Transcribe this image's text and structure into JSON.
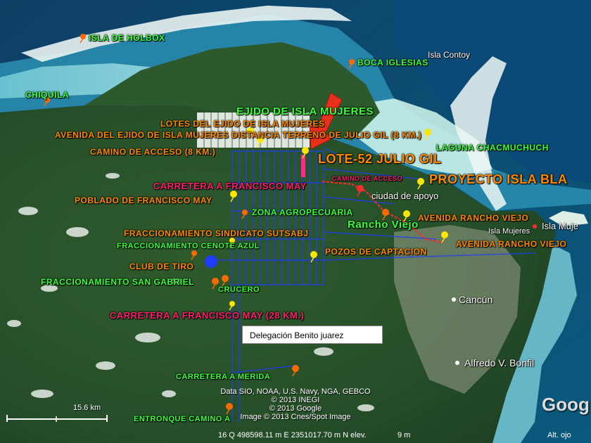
{
  "labels": {
    "isla_holbox": "ISLA DE HOLBOX",
    "boca_iglesias": "BOCA IGLESIAS",
    "isla_contoy": "Isla Contoy",
    "chiquila": "CHIQUILA",
    "ejido_title": "EJIDO DE ISLA MUJERES",
    "lotes_ejido": "LOTES DEL EJIDO DE ISLA MUJERES",
    "avenida_ejido": "AVENIDA DEL EJIDO DE ISLA MUJERES  DISTANCIA TERRENO DE JULIO GIL (8 KM.)",
    "laguna": "LAGUNA CHACMUCHUCH",
    "camino_acceso_8km": "CAMINO DE ACCESO (8 KM.)",
    "lote52": "LOTE-52 JULIO GIL",
    "camino_acceso": "CAMINO DE ACCESO",
    "proyecto": "PROYECTO ISLA BLA",
    "carretera_fm": "CARRETERA A FRANCISCO MAY",
    "ciudad_apoyo": "ciudad de apoyo",
    "poblado_fm": "POBLADO DE FRANCISCO MAY",
    "zona_agro": "ZONA AGROPECUARIA",
    "avenida_rv1": "AVENIDA RANCHO VIEJO",
    "rancho_viejo": "Rancho Viejo",
    "isla_mujeres_small": "Isla Mujeres",
    "isla_mujeres": "Isla Muje",
    "fracc_sutsabj": "FRACCIONAMIENTO SINDICATO SUTSABJ",
    "avenida_rv2": "AVENIDA RANCHO VIEJO",
    "fracc_cenote": "FRACCIONAMIENTO CENOTE AZUL",
    "pozos": "POZOS DE CAPTACION",
    "club_tiro": "CLUB DE TIRO",
    "fracc_san_gabriel": "FRACCIONAMIENTO SAN GABRIEL",
    "crucero": "CRUCERO",
    "cancun": "Cancún",
    "carretera_fm_28": "CARRETERA A FRANCISCO MAY  (28 KM.)",
    "delegacion": "Delegación Benito juarez",
    "alfredo": "Alfredo V. Bonfil",
    "carretera_merida": "CARRETERA A MERIDA",
    "entronque": "ENTRONQUE CAMINO A"
  },
  "credits": {
    "line1": "Data SIO, NOAA, U.S. Navy, NGA, GEBCO",
    "line2": "© 2013 INEGI",
    "line3": "© 2013 Google",
    "line4": "Image © 2013 Cnes/Spot Image"
  },
  "scale_label": "15.6 km",
  "google_logo": "Goog",
  "status": {
    "coords": "16 Q 498598.11 m E 2351017.70 m N elev.",
    "elev": "9 m",
    "alt": "Alt. ojo"
  },
  "colors": {
    "label_orange": "#ff8a00",
    "label_green": "#3cff3c",
    "label_magenta": "#ff1f6b",
    "arrow_red": "#e8311c",
    "grid_blue": "#1f3cff",
    "pin_yellow": "#ffe600",
    "pin_orange": "#ff6a00"
  },
  "icons": [
    "pushpin-icon",
    "red-arrow-icon"
  ]
}
